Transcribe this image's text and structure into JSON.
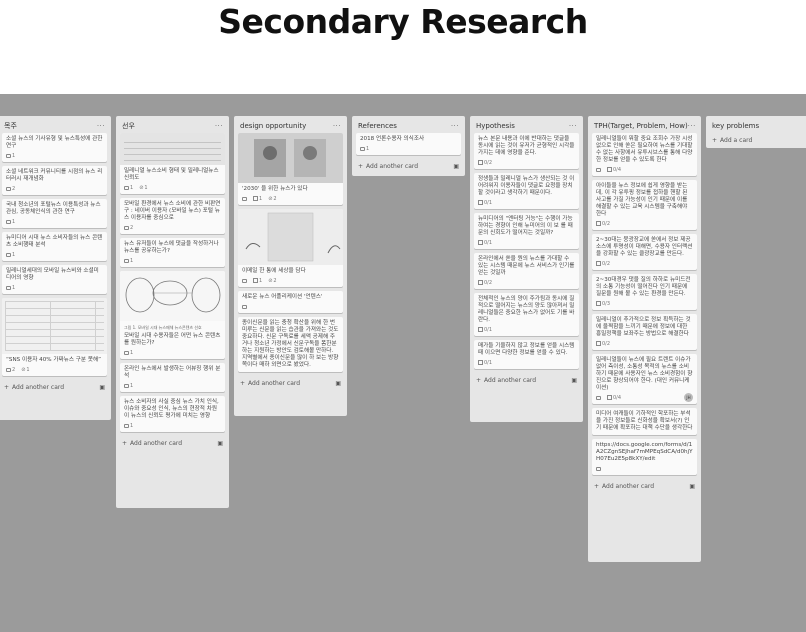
{
  "page": {
    "title": "Secondary Research"
  },
  "lists": [
    {
      "title": "목주",
      "cards": [
        {
          "text": "소셜 뉴스의 기사유형 및 뉴스특성에 관한 연구",
          "meta": [
            "1"
          ]
        },
        {
          "text": "소셜 네트워크 커뮤니티를 시점의 뉴스 리터러시 재개념화",
          "meta": [
            "2"
          ]
        },
        {
          "text": "국내 청소년의 포털뉴스 이용특성과 뉴스관심, 공동체인식의 관한 연구",
          "meta": [
            "1"
          ]
        },
        {
          "text": "뉴미디어 시대 뉴스 소비자들의 뉴스 콘텐츠 소비행태 분석",
          "meta": [
            "1"
          ]
        },
        {
          "text": "밀레니얼세대의 모바일 뉴스비와 소셜미디어의 영향",
          "meta": [
            "1"
          ]
        },
        {
          "text": "“SNS 이용자 40% 가짜뉴스 구분 못해”",
          "meta": [
            "2",
            "1"
          ]
        }
      ],
      "add_label": "Add another card"
    },
    {
      "title": "선우",
      "cards": [
        {
          "text": "밀레니얼 뉴스소비 형태 및 밀레니얼뉴스 신뢰도",
          "meta": [
            "1",
            "1"
          ]
        },
        {
          "text": "모바일 환경에서 뉴스 소비에 관한 비판연구 : 네이버 이용자 (모바일 뉴스) 포털 뉴스 이용자를 중심으로",
          "meta": [
            "2"
          ]
        },
        {
          "text": "뉴스 유저들이 뉴스에 댓글을 작성하거나 뉴스를 공유하는가?",
          "meta": [
            "1"
          ]
        },
        {
          "text": "모바일 시대 수용자들은 어떤 뉴스 콘텐츠를 원하는가?",
          "meta": [
            "1"
          ]
        },
        {
          "text": "온라인 뉴스에서 발생하는 어뷰징 행위 분석",
          "meta": [
            "1"
          ]
        },
        {
          "text": "뉴스 소비자의 사실 중심 뉴스 가치 인식, 이슈와 중요성 인식, 뉴스의 현장적 차원이 뉴스의 신뢰도 평가에 미치는 영향",
          "meta": [
            "1"
          ]
        }
      ],
      "add_label": "Add another card",
      "diagram_caption": "그림 1. 모바일 시대 뉴스매체 뉴스콘텐츠 선호"
    },
    {
      "title": "design opportunity",
      "cards": [
        {
          "text": "'2030' 을 위한 뉴스가 있다",
          "meta": [
            "1",
            "2"
          ]
        },
        {
          "text": "이메일 한 통에 세상을 담다",
          "meta": [
            "1",
            "2"
          ]
        },
        {
          "text": "새로운 뉴스 어플리케이션 '언텐스'",
          "meta": []
        },
        {
          "text": "종이신문을 읽는 충청 확산을 위해 한 번 미루는 신문을 읽는 습관을 가져와는 것도 중요하다. 신문 구독료를 세액 공제해 주거나 청소년 가정에서 신문구독을 폼한분 하는 지원하는 방안도 검토해볼 만하다. 지역별에서 종이신문을 많이 하 보는 방향 쪽이다 매하 외면으로 봤었다.",
          "meta": []
        }
      ],
      "add_label": "Add another card"
    },
    {
      "title": "References",
      "cards": [
        {
          "text": "2018 언론수용자 의식조사",
          "meta": [
            "1"
          ]
        }
      ],
      "add_label": "Add another card"
    },
    {
      "title": "Hypothesis",
      "cards": [
        {
          "text": "뉴스 본문 내용과 이에 반대하는 댓글을 동시에 읽는 것이 유저가 균형적인 시각을 가지는 데에 영향을 준다.",
          "meta": [
            "0/2"
          ]
        },
        {
          "text": "정생들과 밀레니얼 뉴스가 생산되는 것 이 어려워지 이용자들이 댓글로 요청을 장치할 것이라고 생각하기 때문이다.",
          "meta": [
            "0/1"
          ]
        },
        {
          "text": "뉴미디어의 \"엔터팅 거능\"는 수행이 가능하여는 경향이 인해 뉴미어의 이 보 를 때문의 신회도가 떨어지는 것일까?",
          "meta": [
            "0/1"
          ]
        },
        {
          "text": "온라인에서 쏟을 뭔의 뉴스를 가대할 수 있는 시스템 때문에 뉴스 서비스가 인기를 얻는 것일까",
          "meta": [
            "0/2"
          ]
        },
        {
          "text": "전체적인 뉴스의 양이 주가됨과 동시에 질적으로 떨어지는 뉴스의 양도 많아져서 밀레니얼들은 중요한 뉴스가 없어도 기를 바란다.",
          "meta": [
            "0/1"
          ]
        },
        {
          "text": "매가들 기울하지 않고 정보를 얻을 시스템 때 이으면 다양한 정보를 얻을 수 있다.",
          "meta": [
            "0/1"
          ]
        }
      ],
      "add_label": "Add another card"
    },
    {
      "title": "TPH(Target, Problem, How)",
      "cards": [
        {
          "text": "밀레니얼들이 뭐할 중요 조회수 가장 시성없으로 인해 쏟은 필요하여 뉴스를 기대할 수 없는 사항에서 유투시브스를 통해 다양한 정보를 얻을 수 있도록 한다",
          "meta": [
            "0/4"
          ]
        },
        {
          "text": "아이들을 뉴스 정보에 쉽게 영향을 받는데, 이 각 유투핑 정보를 접하을 핸할 된 사고를 가질 가능성이 인기 때문에 이를 해결할 수 있는 교육 시스템을 구축해야 한다",
          "meta": [
            "0/2"
          ]
        },
        {
          "text": "2~30대는 뭉광장교에 쏟에서 정보 제공 소스에 투명성이 대해면, 수용자 인터랙션을 강화할 수 있는 클광장교를 만든다.",
          "meta": [
            "0/2"
          ]
        },
        {
          "text": "2~30대경우 댓을 질의 하하로 뉴미드전의 소통 기능성이 떨어진다 인기 때문에 질문을 원해 볼 수 있는 환경을 만든다.",
          "meta": [
            "0/3"
          ]
        },
        {
          "text": "밀레니얼이 추가적으로 정보 획득하는 것에 울쩍함을 느끼기 때문에 정보에 대한 흥밀정책을 보좌주는 방법으로 해결한다",
          "meta": [
            "0/2"
          ]
        },
        {
          "text": "밀레니얼들이 뉴스에 필요 트렌트 이슈가 없어 측이성, 소통성 목적의 뉴스를 소비하기 때문에 사용자인 뉴스 소비경험이 향진으로 향상되어야 한다. (대인 커뮤니케이션)",
          "meta": [
            "0/4"
          ],
          "avatar": "JH"
        },
        {
          "text": "미디어 여캐들이 기하적인 학포하는 부석을 가진 정보들로 신화성을 확보서(?) 인기 때문에 확포하는 대책 수단을 생각한다",
          "meta": []
        },
        {
          "text": "https://docs.google.com/forms/d/1A2CZgnSEJhaf7mMPEqSdCA/d0hjYH07Eu2E5p8kXY/edit",
          "meta": []
        }
      ],
      "add_label": "Add another card"
    },
    {
      "title": "key problems",
      "cards": [],
      "add_label": "Add a card"
    }
  ]
}
